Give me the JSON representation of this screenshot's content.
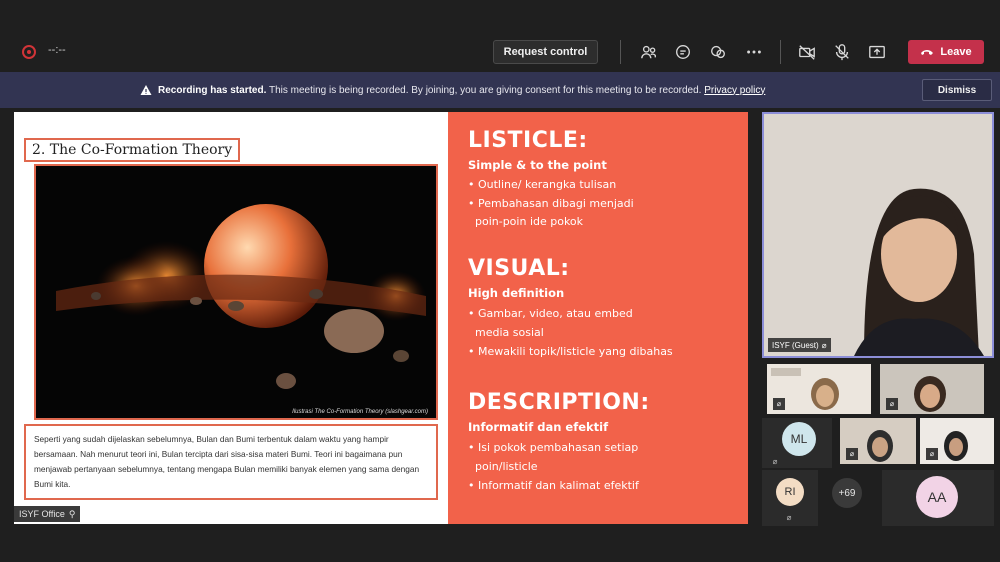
{
  "topbar": {
    "timer": "--:--",
    "request_control": "Request control",
    "leave": "Leave",
    "icons": [
      "people-icon",
      "chat-icon",
      "reactions-icon",
      "more-icon",
      "camera-off-icon",
      "mic-off-icon",
      "share-icon"
    ]
  },
  "banner": {
    "bold": "Recording has started.",
    "text": " This meeting is being recorded. By joining, you are giving consent for this meeting to be recorded.",
    "link": "Privacy policy",
    "dismiss": "Dismiss"
  },
  "slide": {
    "title": "2. The Co-Formation Theory",
    "image_caption": "Ilustrasi The Co-Formation Theory (slashgear.com)",
    "description": "Seperti yang sudah dijelaskan sebelumnya, Bulan dan Bumi terbentuk dalam waktu yang hampir bersamaan. Nah menurut teori ini, Bulan tercipta dari sisa-sisa materi Bumi. Teori ini bagaimana pun menjawab pertanyaan sebelumnya, tentang mengapa Bulan memiliki banyak elemen yang sama dengan Bumi kita.",
    "sections": [
      {
        "heading": "LISTICLE:",
        "sub": "Simple & to the point",
        "items": [
          "• Outline/ kerangka tulisan",
          "• Pembahasan dibagi menjadi",
          "  poin-poin ide pokok"
        ]
      },
      {
        "heading": "VISUAL:",
        "sub": "High definition",
        "items": [
          "• Gambar, video, atau embed",
          "  media sosial",
          "• Mewakili topik/listicle yang dibahas"
        ]
      },
      {
        "heading": "DESCRIPTION:",
        "sub": "Informatif dan efektif",
        "items": [
          "• Isi pokok pembahasan setiap",
          "  poin/listicle",
          "• Informatif dan kalimat efektif"
        ]
      }
    ]
  },
  "presenter_tag": "ISYF Office",
  "participants": {
    "main_name": "ISYF (Guest)",
    "avatars": [
      {
        "initials": "ML",
        "color": "#cfe6ec"
      },
      {
        "initials": "RI",
        "color": "#f3dcc4"
      },
      {
        "initials": "AA",
        "color": "#f2d3e6"
      }
    ],
    "overflow_count": "+69"
  }
}
